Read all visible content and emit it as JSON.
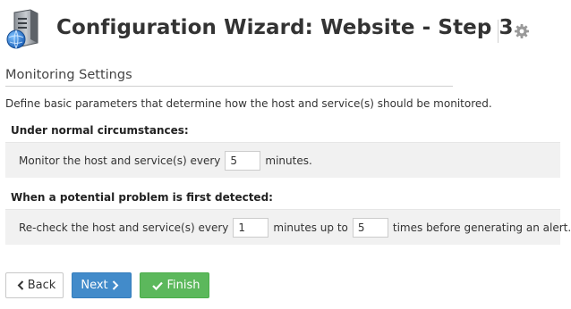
{
  "header": {
    "title": "Configuration Wizard: Website - Step 3",
    "app_icon": "server-globe-icon",
    "settings_icon": "gear-icon"
  },
  "section": {
    "title": "Monitoring Settings",
    "description": "Define basic parameters that determine how the host and service(s) should be monitored."
  },
  "normal": {
    "heading": "Under normal circumstances:",
    "prefix": "Monitor the host and service(s) every",
    "interval_value": "5",
    "suffix": "minutes."
  },
  "problem": {
    "heading": "When a potential problem is first detected:",
    "prefix": "Re-check the host and service(s) every",
    "retry_interval_value": "1",
    "middle": "minutes up to",
    "max_attempts_value": "5",
    "suffix": "times before generating an alert."
  },
  "buttons": {
    "back_label": "Back",
    "next_label": "Next",
    "finish_label": "Finish",
    "back_icon": "chevron-left-icon",
    "next_icon": "chevron-right-icon",
    "finish_icon": "check-icon"
  },
  "colors": {
    "next_button": "#428bca",
    "finish_button": "#5cb85c"
  }
}
